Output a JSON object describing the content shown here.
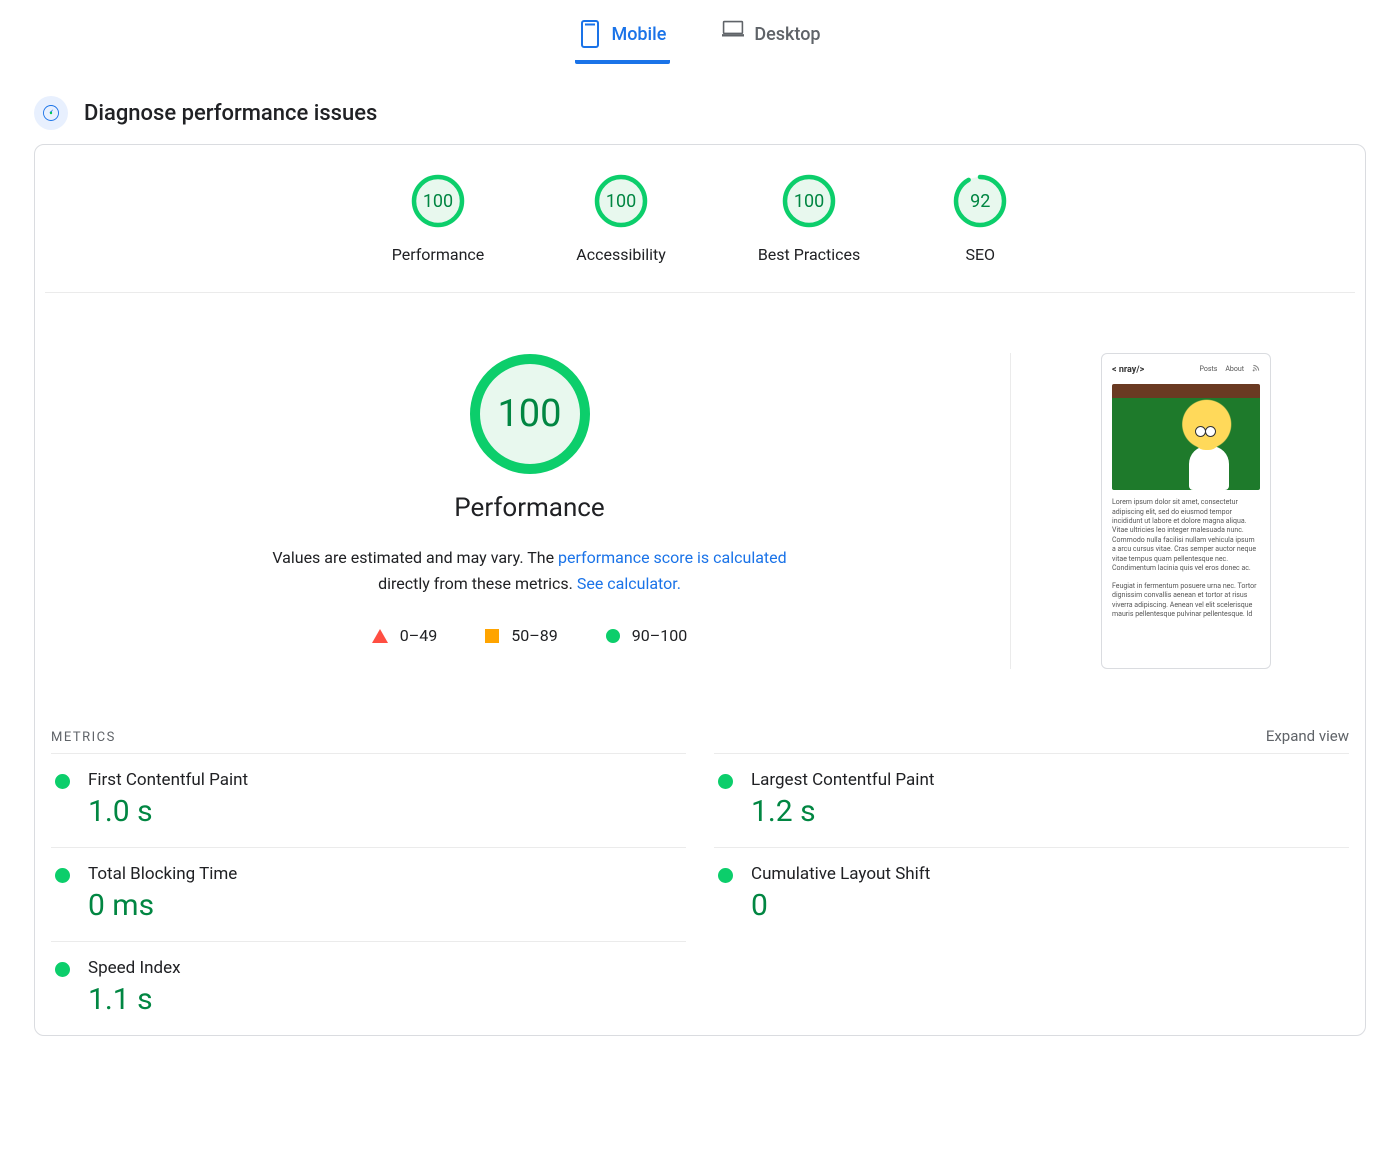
{
  "tabs": {
    "mobile": "Mobile",
    "desktop": "Desktop",
    "active": "mobile"
  },
  "section_title": "Diagnose performance issues",
  "gauges": [
    {
      "label": "Performance",
      "score": 100,
      "pct": 100
    },
    {
      "label": "Accessibility",
      "score": 100,
      "pct": 100
    },
    {
      "label": "Best Practices",
      "score": 100,
      "pct": 100
    },
    {
      "label": "SEO",
      "score": 92,
      "pct": 92
    }
  ],
  "performance": {
    "score": 100,
    "title": "Performance",
    "desc_prefix": "Values are estimated and may vary. The ",
    "desc_link1": "performance score is calculated",
    "desc_middle": " directly from these metrics. ",
    "desc_link2": "See calculator.",
    "legend": [
      {
        "shape": "triangle",
        "range": "0–49"
      },
      {
        "shape": "square",
        "range": "50–89"
      },
      {
        "shape": "circle",
        "range": "90–100"
      }
    ]
  },
  "preview": {
    "logo": "< nray/>",
    "nav": [
      "Posts",
      "About"
    ],
    "para1": "Lorem ipsum dolor sit amet, consectetur adipiscing elit, sed do eiusmod tempor incididunt ut labore et dolore magna aliqua. Vitae ultricies leo integer malesuada nunc. Commodo nulla facilisi nullam vehicula ipsum a arcu cursus vitae. Cras semper auctor neque vitae tempus quam pellentesque nec. Condimentum lacinia quis vel eros donec ac.",
    "para2": "Feugiat in fermentum posuere urna nec. Tortor dignissim convallis aenean et tortor at risus viverra adipiscing. Aenean vel elit scelerisque mauris pellentesque pulvinar pellentesque. Id"
  },
  "metrics_header": "METRICS",
  "expand_label": "Expand view",
  "metrics": [
    {
      "name": "First Contentful Paint",
      "value": "1.0 s",
      "status": "good"
    },
    {
      "name": "Largest Contentful Paint",
      "value": "1.2 s",
      "status": "good"
    },
    {
      "name": "Total Blocking Time",
      "value": "0 ms",
      "status": "good"
    },
    {
      "name": "Cumulative Layout Shift",
      "value": "0",
      "status": "good"
    },
    {
      "name": "Speed Index",
      "value": "1.1 s",
      "status": "good"
    }
  ]
}
